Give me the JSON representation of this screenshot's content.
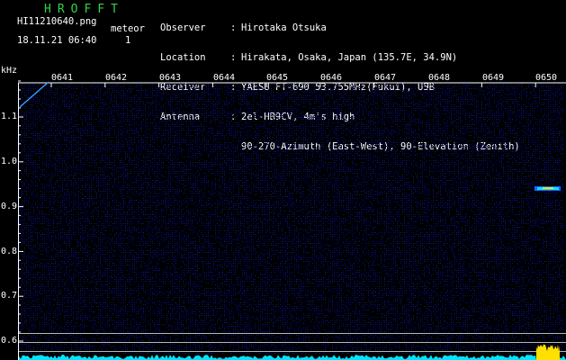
{
  "logo": "HROFFT",
  "file": "HI11210640.png",
  "datetime": "18.11.21 06:40",
  "meteor": {
    "label": "meteor",
    "count": "1"
  },
  "info": [
    {
      "key": "Observer",
      "value": "Hirotaka Otsuka"
    },
    {
      "key": "Location",
      "value": "Hirakata, Osaka, Japan (135.7E, 34.9N)"
    },
    {
      "key": "Receiver",
      "value": "YAESU FT-690 53.755MHz(Fukui), USB"
    },
    {
      "key": "Antenna",
      "value": "2el-HB9CV, 4m's high"
    },
    {
      "key": "",
      "value": "90-270-Azimuth (East-West), 90-Elevation (Zenith)"
    }
  ],
  "y_unit": "kHz",
  "x_ticks": [
    "0641",
    "0642",
    "0643",
    "0644",
    "0645",
    "0646",
    "0647",
    "0648",
    "0649",
    "0650"
  ],
  "y_ticks": [
    "1.1",
    "1.0",
    "0.9",
    "0.8",
    "0.7",
    "0.6"
  ],
  "colors": {
    "logo": "#2fd34a",
    "background": "#000000",
    "noise": "#1a1a7a",
    "signal": "#00e5ff",
    "hot": "#ffe000"
  }
}
